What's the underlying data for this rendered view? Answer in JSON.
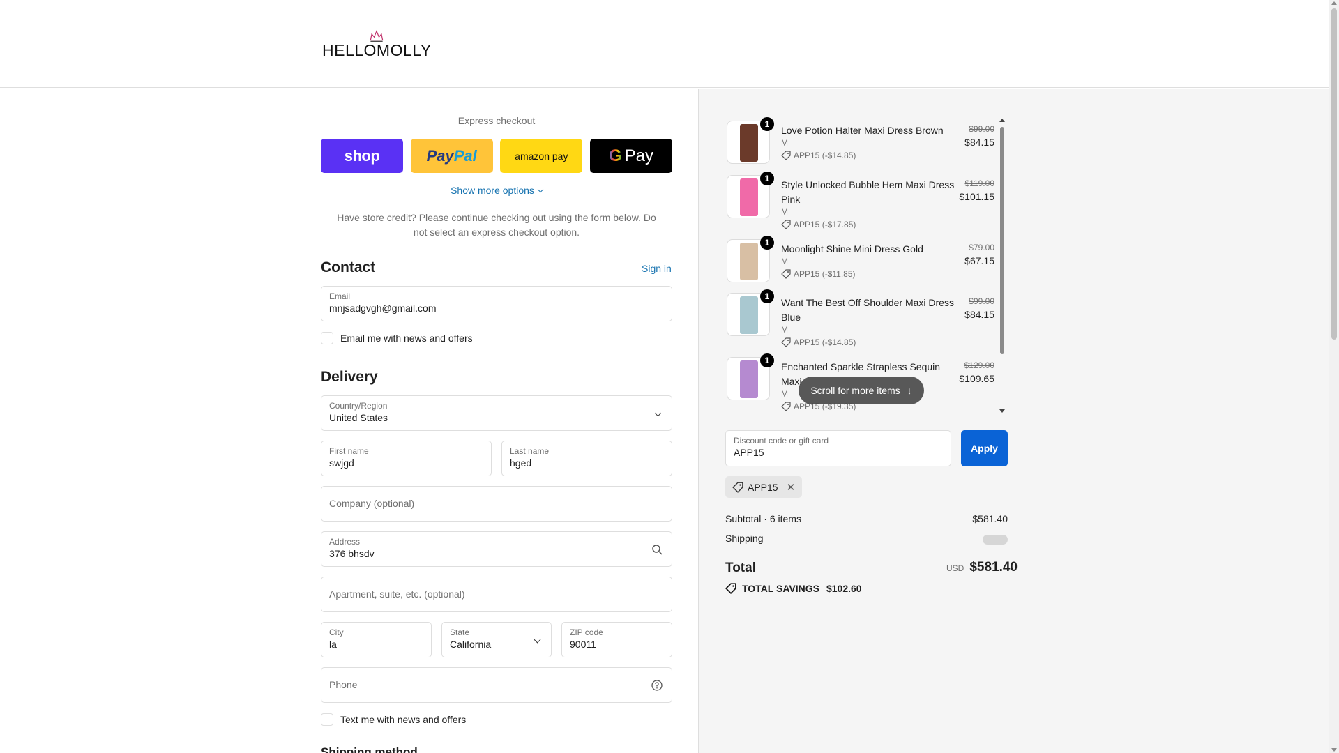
{
  "brand": {
    "logo_text": "HELLOMOLLY"
  },
  "express": {
    "title": "Express checkout",
    "shop_label": "shop",
    "paypal_label_a": "Pay",
    "paypal_label_b": "Pal",
    "amazon_label": "amazon pay",
    "gpay_label": "Pay",
    "gpay_g": "G",
    "more_options": "Show more options",
    "store_credit_note": "Have store credit? Please continue checking out using the form below. Do not select an express checkout option."
  },
  "contact": {
    "title": "Contact",
    "sign_in": "Sign in",
    "email_label": "Email",
    "email_value": "mnjsadgvgh@gmail.com",
    "email_opt_in": "Email me with news and offers"
  },
  "delivery": {
    "title": "Delivery",
    "country_label": "Country/Region",
    "country_value": "United States",
    "first_name_label": "First name",
    "first_name_value": "swjgd",
    "last_name_label": "Last name",
    "last_name_value": "hged",
    "company_placeholder": "Company (optional)",
    "address_label": "Address",
    "address_value": "376 bhsdv",
    "apartment_placeholder": "Apartment, suite, etc. (optional)",
    "city_label": "City",
    "city_value": "la",
    "state_label": "State",
    "state_value": "California",
    "zip_label": "ZIP code",
    "zip_value": "90011",
    "phone_placeholder": "Phone",
    "sms_opt_in": "Text me with news and offers"
  },
  "shipping_method": {
    "title": "Shipping method"
  },
  "cart": {
    "items": [
      {
        "qty": "1",
        "name": "Love Potion Halter Maxi Dress Brown",
        "variant": "M",
        "discount": "APP15 (-$14.85)",
        "price_old": "$99.00",
        "price_new": "$84.15",
        "color": "#6b3a2a"
      },
      {
        "qty": "1",
        "name": "Style Unlocked Bubble Hem Maxi Dress Pink",
        "variant": "M",
        "discount": "APP15 (-$17.85)",
        "price_old": "$119.00",
        "price_new": "$101.15",
        "color": "#f06aa8"
      },
      {
        "qty": "1",
        "name": "Moonlight Shine Mini Dress Gold",
        "variant": "M",
        "discount": "APP15 (-$11.85)",
        "price_old": "$79.00",
        "price_new": "$67.15",
        "color": "#d8bfa4"
      },
      {
        "qty": "1",
        "name": "Want The Best Off Shoulder Maxi Dress Blue",
        "variant": "M",
        "discount": "APP15 (-$14.85)",
        "price_old": "$99.00",
        "price_new": "$84.15",
        "color": "#a9c8d0"
      },
      {
        "qty": "1",
        "name": "Enchanted Sparkle Strapless Sequin Maxi",
        "variant": "M",
        "discount": "APP15 (-$19.35)",
        "price_old": "$129.00",
        "price_new": "$109.65",
        "color": "#b58ad0"
      }
    ],
    "scroll_hint": "Scroll for more items",
    "discount_label": "Discount code or gift card",
    "discount_value": "APP15",
    "apply_label": "Apply",
    "applied_code": "APP15",
    "subtotal_label": "Subtotal · 6 items",
    "subtotal_value": "$581.40",
    "shipping_label": "Shipping",
    "total_label": "Total",
    "currency": "USD",
    "total_value": "$581.40",
    "savings_label": "TOTAL SAVINGS",
    "savings_value": "$102.60"
  },
  "colors": {
    "accent": "#1773b0",
    "apply": "#0a63d6",
    "shop": "#5a31f4",
    "paypal": "#ffc439",
    "amazon": "#ffd814"
  }
}
